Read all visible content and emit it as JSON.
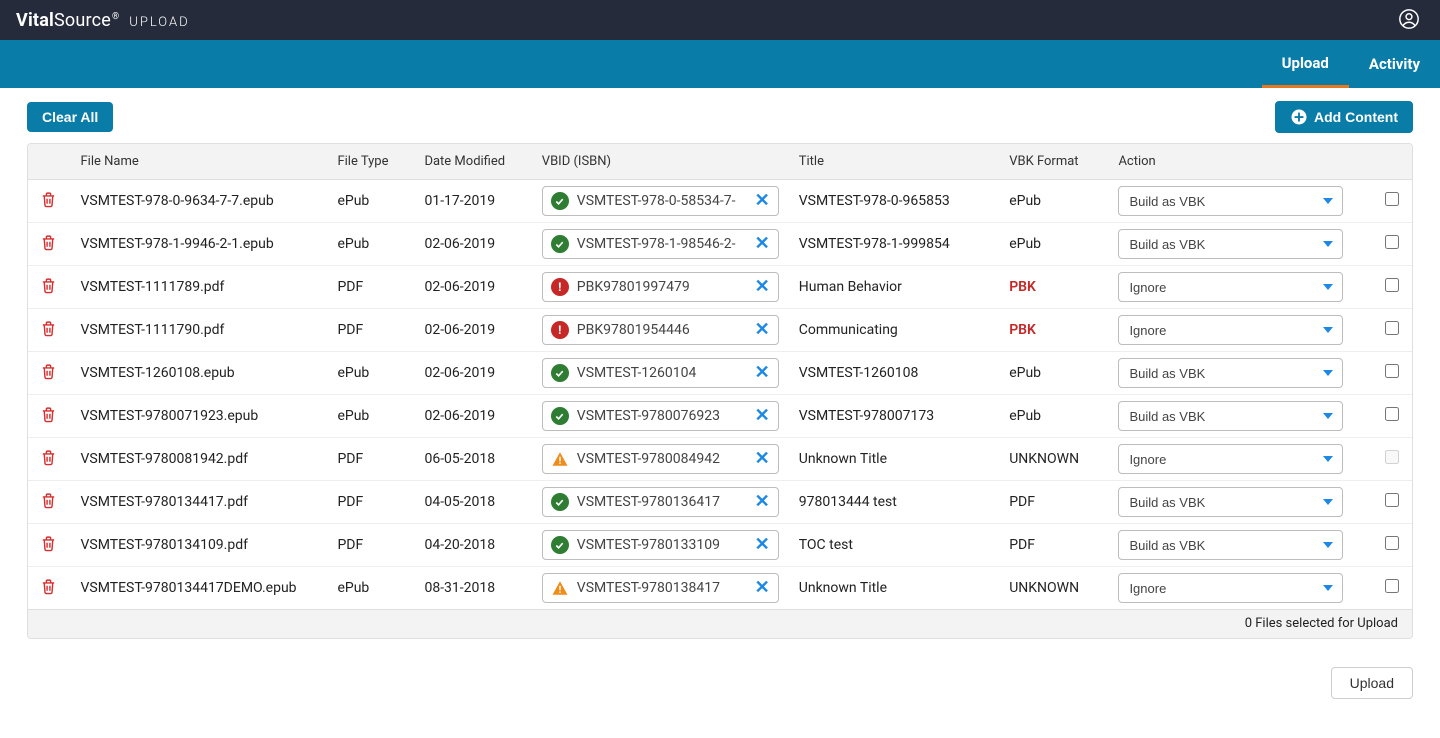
{
  "brand": {
    "name_bold": "Vital",
    "name_light": "Source",
    "suffix": "®",
    "sub": "UPLOAD"
  },
  "tabs": {
    "upload": "Upload",
    "activity": "Activity"
  },
  "actions": {
    "clear_all": "Clear All",
    "add_content": "Add Content",
    "upload": "Upload"
  },
  "columns": {
    "file_name": "File Name",
    "file_type": "File Type",
    "date_modified": "Date Modified",
    "vbid": "VBID (ISBN)",
    "title": "Title",
    "vbk_format": "VBK Format",
    "action": "Action"
  },
  "footer": "0 Files selected for Upload",
  "select_options": [
    "Build as VBK",
    "Ignore"
  ],
  "rows": [
    {
      "file_name": "VSMTEST-978-0-9634-7-7.epub",
      "file_type": "ePub",
      "date": "01-17-2019",
      "vbid_status": "ok",
      "vbid": "VSMTEST-978-0-58534-7-",
      "title": "VSMTEST-978-0-965853",
      "fmt": "ePub",
      "fmt_style": "",
      "action": "Build as VBK",
      "chk_disabled": false
    },
    {
      "file_name": "VSMTEST-978-1-9946-2-1.epub",
      "file_type": "ePub",
      "date": "02-06-2019",
      "vbid_status": "ok",
      "vbid": "VSMTEST-978-1-98546-2-",
      "title": "VSMTEST-978-1-999854",
      "fmt": "ePub",
      "fmt_style": "",
      "action": "Build as VBK",
      "chk_disabled": false
    },
    {
      "file_name": "VSMTEST-1111789.pdf",
      "file_type": "PDF",
      "date": "02-06-2019",
      "vbid_status": "err",
      "vbid": "PBK97801997479",
      "title": "Human Behavior",
      "fmt": "PBK",
      "fmt_style": "red",
      "action": "Ignore",
      "chk_disabled": false
    },
    {
      "file_name": "VSMTEST-1111790.pdf",
      "file_type": "PDF",
      "date": "02-06-2019",
      "vbid_status": "err",
      "vbid": "PBK97801954446",
      "title": "Communicating",
      "fmt": "PBK",
      "fmt_style": "red",
      "action": "Ignore",
      "chk_disabled": false
    },
    {
      "file_name": "VSMTEST-1260108.epub",
      "file_type": "ePub",
      "date": "02-06-2019",
      "vbid_status": "ok",
      "vbid": "VSMTEST-1260104",
      "title": "VSMTEST-1260108",
      "fmt": "ePub",
      "fmt_style": "",
      "action": "Build as VBK",
      "chk_disabled": false
    },
    {
      "file_name": "VSMTEST-9780071923.epub",
      "file_type": "ePub",
      "date": "02-06-2019",
      "vbid_status": "ok",
      "vbid": "VSMTEST-9780076923",
      "title": "VSMTEST-978007173",
      "fmt": "ePub",
      "fmt_style": "",
      "action": "Build as VBK",
      "chk_disabled": false
    },
    {
      "file_name": "VSMTEST-9780081942.pdf",
      "file_type": "PDF",
      "date": "06-05-2018",
      "vbid_status": "warn",
      "vbid": "VSMTEST-9780084942",
      "title": "Unknown Title",
      "fmt": "UNKNOWN",
      "fmt_style": "",
      "action": "Ignore",
      "chk_disabled": true
    },
    {
      "file_name": "VSMTEST-9780134417.pdf",
      "file_type": "PDF",
      "date": "04-05-2018",
      "vbid_status": "ok",
      "vbid": "VSMTEST-9780136417",
      "title": "978013444 test",
      "fmt": "PDF",
      "fmt_style": "",
      "action": "Build as VBK",
      "chk_disabled": false
    },
    {
      "file_name": "VSMTEST-9780134109.pdf",
      "file_type": "PDF",
      "date": "04-20-2018",
      "vbid_status": "ok",
      "vbid": "VSMTEST-9780133109",
      "title": "TOC test",
      "fmt": "PDF",
      "fmt_style": "",
      "action": "Build as VBK",
      "chk_disabled": false
    },
    {
      "file_name": "VSMTEST-9780134417DEMO.epub",
      "file_type": "ePub",
      "date": "08-31-2018",
      "vbid_status": "warn",
      "vbid": "VSMTEST-9780138417",
      "title": "Unknown Title",
      "fmt": "UNKNOWN",
      "fmt_style": "",
      "action": "Ignore",
      "chk_disabled": false
    }
  ]
}
